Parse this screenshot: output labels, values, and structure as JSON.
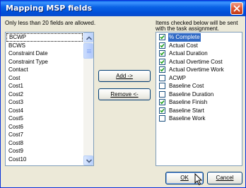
{
  "window": {
    "title": "Mapping MSP fields",
    "close_icon": "close-icon",
    "accent": "#0a5fe8"
  },
  "left_label": "Only less than 20 fields are allowed.",
  "right_label_line1": "Items checked below will be sent",
  "right_label_line2": "with the task assignment.",
  "available_fields": [
    "BCWP",
    "BCWS",
    "Constraint Date",
    "Constraint Type",
    "Contact",
    "Cost",
    "Cost1",
    "Cost2",
    "Cost3",
    "Cost4",
    "Cost5",
    "Cost6",
    "Cost7",
    "Cost8",
    "Cost9",
    "Cost10"
  ],
  "selected_available_field": "BCWP",
  "buttons": {
    "add": "Add ->",
    "remove": "Remove <-",
    "ok": "OK",
    "cancel": "Cancel"
  },
  "checked_fields": [
    {
      "label": "% Complete",
      "checked": true,
      "highlighted": true
    },
    {
      "label": "Actual Cost",
      "checked": true,
      "highlighted": false
    },
    {
      "label": "Actual Duration",
      "checked": true,
      "highlighted": false
    },
    {
      "label": "Actual Overtime Cost",
      "checked": true,
      "highlighted": false
    },
    {
      "label": "Actual Overtime Work",
      "checked": true,
      "highlighted": false
    },
    {
      "label": "ACWP",
      "checked": false,
      "highlighted": false
    },
    {
      "label": "Baseline Cost",
      "checked": false,
      "highlighted": false
    },
    {
      "label": "Baseline Duration",
      "checked": false,
      "highlighted": false
    },
    {
      "label": "Baseline Finish",
      "checked": true,
      "highlighted": false
    },
    {
      "label": "Baseline Start",
      "checked": true,
      "highlighted": false
    },
    {
      "label": "Baseline Work",
      "checked": false,
      "highlighted": false
    }
  ],
  "icons": {
    "scroll_up": "scroll-up-arrow-icon",
    "scroll_down": "scroll-down-arrow-icon",
    "cursor": "mouse-cursor-icon",
    "check": "checkmark-icon"
  }
}
